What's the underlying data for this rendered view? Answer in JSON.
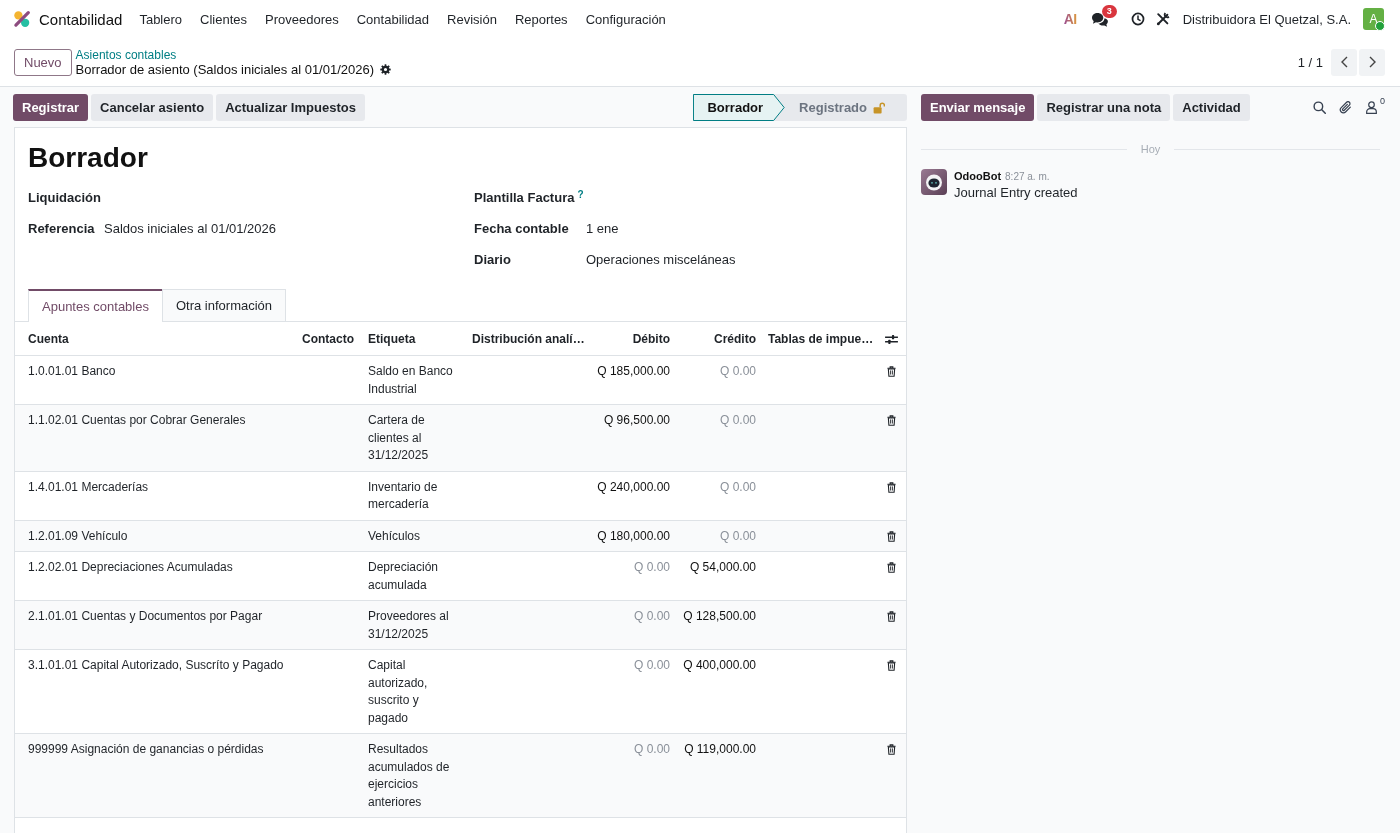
{
  "navbar": {
    "app_name": "Contabilidad",
    "menus": [
      "Tablero",
      "Clientes",
      "Proveedores",
      "Contabilidad",
      "Revisión",
      "Reportes",
      "Configuración"
    ],
    "ai_label": "AI",
    "chat_badge": "3",
    "company": "Distribuidora El Quetzal, S.A.",
    "avatar_letter": "A",
    "online": true
  },
  "control_panel": {
    "new_button": "Nuevo",
    "breadcrumb": "Asientos contables",
    "record_title": "Borrador de asiento (Saldos iniciales al 01/01/2026)",
    "pager": "1 / 1"
  },
  "actions": [
    {
      "label": "Registrar",
      "kind": "primary"
    },
    {
      "label": "Cancelar asiento",
      "kind": "secondary"
    },
    {
      "label": "Actualizar Impuestos",
      "kind": "secondary"
    }
  ],
  "statusbar": [
    {
      "label": "Borrador",
      "selected": true,
      "lock": false
    },
    {
      "label": "Registrado",
      "selected": false,
      "lock": true
    }
  ],
  "form": {
    "title": "Borrador",
    "left_fields": [
      {
        "label": "Liquidación"
      },
      {
        "label": "Referencia",
        "value": "Saldos iniciales al 01/01/2026"
      }
    ],
    "right_fields": [
      {
        "label": "Plantilla Factura",
        "help": "?"
      },
      {
        "label": "Fecha contable",
        "value": "1 ene"
      },
      {
        "label": "Diario",
        "value": "Operaciones misceláneas"
      }
    ],
    "tabs": [
      {
        "label": "Apuntes contables",
        "selected": true
      },
      {
        "label": "Otra información",
        "selected": false
      }
    ]
  },
  "table": {
    "columns": [
      "Cuenta",
      "Contacto",
      "Etiqueta",
      "Distribución analí…",
      "Débito",
      "Crédito",
      "Tablas de impue…"
    ],
    "rows": [
      {
        "account": "1.0.01.01 Banco",
        "label": "Saldo en Banco Industrial",
        "debit": {
          "text": "Q 185,000.00",
          "muted": false
        },
        "credit": {
          "text": "Q 0.00",
          "muted": true
        }
      },
      {
        "account": "1.1.02.01 Cuentas por Cobrar Generales",
        "label": "Cartera de clientes al 31/12/2025",
        "debit": {
          "text": "Q 96,500.00",
          "muted": false
        },
        "credit": {
          "text": "Q 0.00",
          "muted": true
        }
      },
      {
        "account": "1.4.01.01 Mercaderías",
        "label": "Inventario de mercadería",
        "debit": {
          "text": "Q 240,000.00",
          "muted": false
        },
        "credit": {
          "text": "Q 0.00",
          "muted": true
        }
      },
      {
        "account": "1.2.01.09 Vehículo",
        "label": "Vehículos",
        "debit": {
          "text": "Q 180,000.00",
          "muted": false
        },
        "credit": {
          "text": "Q 0.00",
          "muted": true
        }
      },
      {
        "account": "1.2.02.01 Depreciaciones Acumuladas",
        "label": "Depreciación acumulada",
        "debit": {
          "text": "Q 0.00",
          "muted": true
        },
        "credit": {
          "text": "Q 54,000.00",
          "muted": false
        }
      },
      {
        "account": "2.1.01.01 Cuentas y Documentos por Pagar",
        "label": "Proveedores al 31/12/2025",
        "debit": {
          "text": "Q 0.00",
          "muted": true
        },
        "credit": {
          "text": "Q 128,500.00",
          "muted": false
        }
      },
      {
        "account": "3.1.01.01 Capital Autorizado, Suscríto y Pagado",
        "label": "Capital autorizado, suscrito y pagado",
        "debit": {
          "text": "Q 0.00",
          "muted": true
        },
        "credit": {
          "text": "Q 400,000.00",
          "muted": false
        }
      },
      {
        "account": "999999 Asignación de ganancias o pérdidas",
        "label": "Resultados acumulados de ejercicios anteriores",
        "debit": {
          "text": "Q 0.00",
          "muted": true
        },
        "credit": {
          "text": "Q 119,000.00",
          "muted": false
        }
      }
    ]
  },
  "chatter": {
    "buttons": [
      {
        "label": "Enviar mensaje",
        "kind": "primary"
      },
      {
        "label": "Registrar una nota",
        "kind": "secondary"
      },
      {
        "label": "Actividad",
        "kind": "secondary"
      }
    ],
    "followers_count": "0",
    "date_separator": "Hoy",
    "messages": [
      {
        "author": "OdooBot",
        "time": "8:27 a. m.",
        "body": "Journal Entry created"
      }
    ]
  }
}
